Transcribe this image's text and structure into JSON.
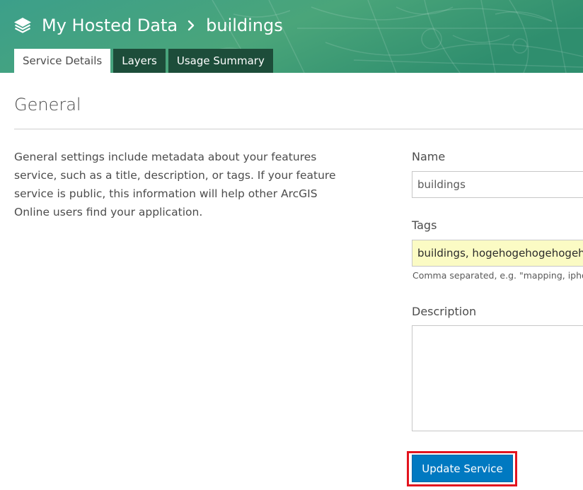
{
  "header": {
    "icon": "layers-icon",
    "breadcrumb_parent": "My Hosted Data",
    "breadcrumb_separator_icon": "chevron-right-icon",
    "breadcrumb_current": "buildings",
    "tabs": [
      {
        "label": "Service Details",
        "active": true
      },
      {
        "label": "Layers",
        "active": false
      },
      {
        "label": "Usage Summary",
        "active": false
      }
    ]
  },
  "main": {
    "section_title": "General",
    "description": "General settings include metadata about your features service, such as a title, description, or tags. If your feature service is public, this information will help other ArcGIS Online users find your application.",
    "form": {
      "name_label": "Name",
      "name_value": "buildings",
      "tags_label": "Tags",
      "tags_value": "buildings, hogehogehogehogeh",
      "tags_hint": "Comma separated, e.g. \"mapping, ipho",
      "description_label": "Description",
      "description_value": "",
      "submit_label": "Update Service"
    }
  },
  "colors": {
    "header_gradient_start": "#1f7a8c",
    "header_gradient_end": "#4aa66a",
    "tab_inactive": "#1d4d3a",
    "tags_highlight": "#fbfbc4",
    "primary_button": "#0079c1",
    "annotation_box": "#e3141e"
  }
}
